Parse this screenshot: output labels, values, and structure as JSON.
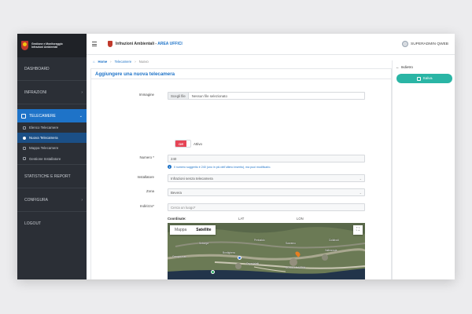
{
  "brand": {
    "line1": "Gestione e Monitoraggio",
    "line2": "Infrazioni Ambientali"
  },
  "sidebar": {
    "dashboard": "DASHBOARD",
    "infrazioni": "INFRAZIONI",
    "telecamere": "TELECAMERE",
    "sub_items": [
      "Elenco Telecamere",
      "Nuova Telecamera",
      "Mappa Telecamere",
      "Gestione Installatore"
    ],
    "statistiche": "STATISTICHE E REPORT",
    "configura": "CONFIGURA",
    "logout": "LOGOUT"
  },
  "header": {
    "app_title": "Infrazioni Ambientali - ",
    "app_area": "AREA UFFICI",
    "user_name": "SUPERADMIN QWEB"
  },
  "breadcrumb": {
    "home": "Home",
    "section": "Telecamere",
    "current": "Nuovo"
  },
  "form": {
    "title": "Aggiungere una nuova telecamera",
    "image_label": "Immagine",
    "file_button": "Scegli file",
    "file_status": "Nessun file selezionato",
    "toggle_state": "Off",
    "toggle_label": "Attivo",
    "number_label": "Numero *",
    "number_value": "240",
    "number_hint": "Il numero suggerito è 240 (uno in più dell'ultimo inserito), ma puoi modificarlo.",
    "installer_label": "Installatore",
    "installer_value": "Infrazioni senza telecamera",
    "zone_label": "Zona",
    "zone_value": "Bevera",
    "address_label": "Indirizzo*",
    "address_placeholder": "Cerca un luogo*",
    "coords_label": "Coordinate:",
    "lat_label": "LAT",
    "lon_label": "LON"
  },
  "map": {
    "tab_map": "Mappa",
    "tab_satellite": "Satellite",
    "fullscreen_icon": "fullscreen-icon",
    "place_labels": [
      "Sanremo",
      "Camporosso",
      "Vallecrosia",
      "Bordighera",
      "Ospedaletti",
      "Coldirodi",
      "Seborga",
      "Perinaldo",
      "CORSO MAZZINI"
    ],
    "colors": {
      "land": "#6d7b58",
      "sea": "#22344a"
    }
  },
  "right_panel": {
    "back_label": "Indietro",
    "save_label": "Salva",
    "accent": "#2ab5a5"
  },
  "colors": {
    "primary": "#1e73c8",
    "sidebar": "#2b2f36",
    "danger": "#e64556"
  }
}
